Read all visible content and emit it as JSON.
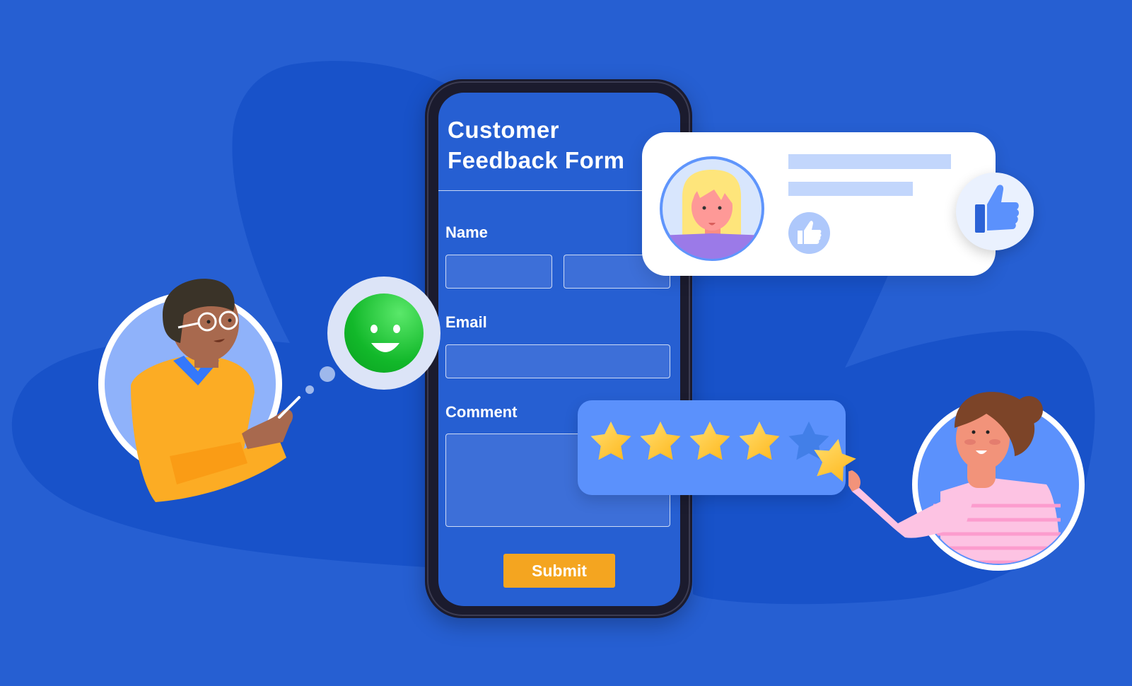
{
  "scene": {
    "description": "Customer feedback illustration",
    "colors": {
      "background": "#265fd2",
      "blob": "#1852c9",
      "phone_frame": "#1b1b2e",
      "screen": "#265fd2",
      "accent_submit": "#f4a520",
      "rating_card": "#5b91fc",
      "star_gold": "#ffc533",
      "smiley_green": "#12b82a"
    }
  },
  "form": {
    "title_line1": "Customer",
    "title_line2": "Feedback Form",
    "name_label": "Name",
    "first_name_value": "",
    "last_name_value": "",
    "email_label": "Email",
    "email_value": "",
    "comment_label": "Comment",
    "comment_value": "",
    "submit_label": "Submit"
  },
  "review_card": {
    "icons": [
      "user-avatar-blonde-woman",
      "thumbs-up-icon"
    ],
    "badge_icon": "thumbs-up-icon"
  },
  "rating": {
    "max_stars": 5,
    "filled_stars": 4,
    "star_being_placed": 1
  },
  "reaction": {
    "icon": "smiley-face-icon",
    "mood": "happy"
  },
  "characters": [
    {
      "name": "man-with-glasses",
      "holding": "phone"
    },
    {
      "name": "woman-with-bun",
      "holding": "star"
    }
  ]
}
